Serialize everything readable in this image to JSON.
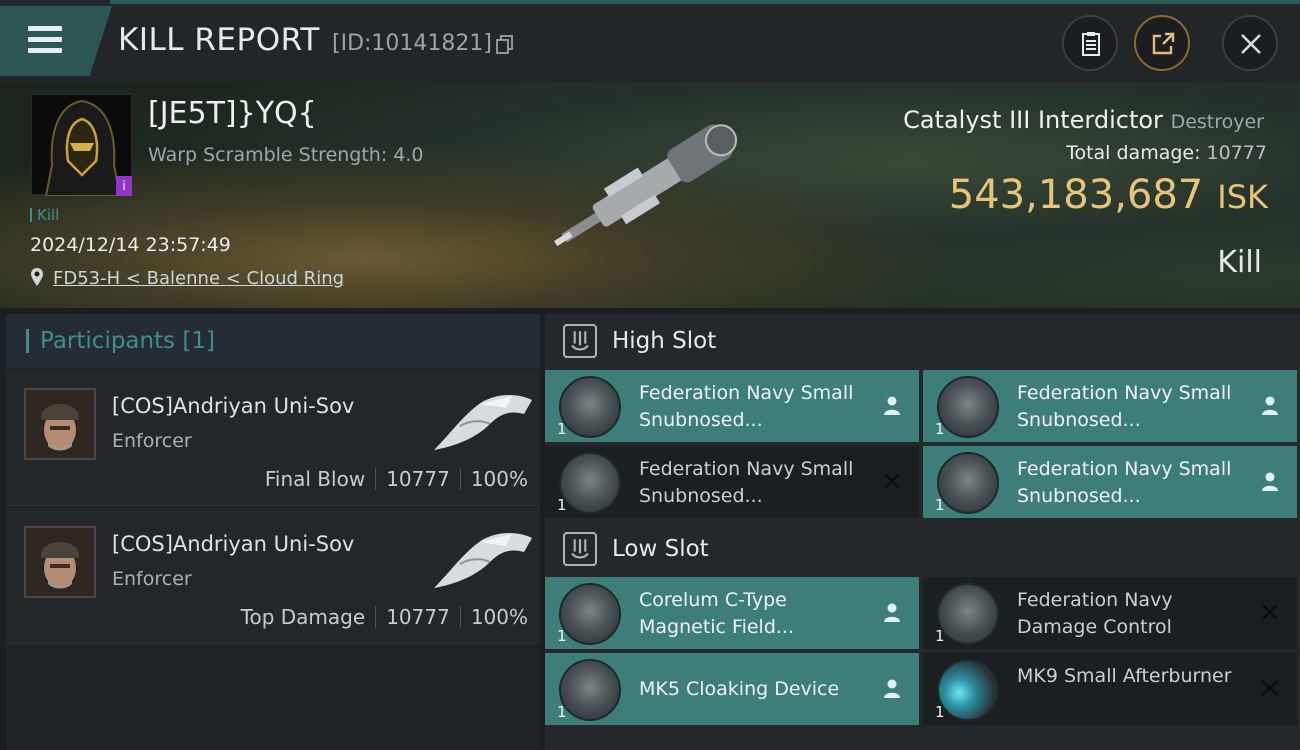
{
  "header": {
    "title": "KILL REPORT",
    "report_id": "[ID:10141821]",
    "buttons": [
      "clipboard-icon",
      "share-icon",
      "close-icon"
    ]
  },
  "victim": {
    "name": "[JE5T]}YQ{",
    "scramble": "Warp Scramble Strength: 4.0",
    "tag": "Kill",
    "datetime": "2024/12/14 23:57:49",
    "location": "FD53-H < Balenne < Cloud Ring",
    "ship_name": "Catalyst III Interdictor",
    "ship_class": "Destroyer",
    "total_damage_label": "Total damage:",
    "total_damage": "10777",
    "isk_value": "543,183,687",
    "isk_unit": "ISK",
    "result": "Kill",
    "info_badge": "i"
  },
  "participants": {
    "title": "Participants [1]",
    "rows": [
      {
        "name": "[COS]Andriyan Uni-Sov",
        "ship": "Enforcer",
        "role": "Final Blow",
        "damage": "10777",
        "percent": "100%"
      },
      {
        "name": "[COS]Andriyan Uni-Sov",
        "ship": "Enforcer",
        "role": "Top Damage",
        "damage": "10777",
        "percent": "100%"
      }
    ]
  },
  "slots": {
    "high": {
      "label": "High Slot",
      "modules": [
        {
          "name": "Federation Navy Small Snubnosed...",
          "qty": "1",
          "status": "dropped"
        },
        {
          "name": "Federation Navy Small Snubnosed...",
          "qty": "1",
          "status": "dropped"
        },
        {
          "name": "Federation Navy Small Snubnosed...",
          "qty": "1",
          "status": "destroyed"
        },
        {
          "name": "Federation Navy Small Snubnosed...",
          "qty": "1",
          "status": "dropped"
        }
      ]
    },
    "low": {
      "label": "Low Slot",
      "modules": [
        {
          "name": "Corelum C-Type Magnetic Field...",
          "qty": "1",
          "status": "dropped"
        },
        {
          "name": "Federation Navy Damage Control",
          "qty": "1",
          "status": "destroyed"
        },
        {
          "name": "MK5 Cloaking Device",
          "qty": "1",
          "status": "dropped"
        },
        {
          "name": "MK9 Small Afterburner",
          "qty": "1",
          "status": "destroyed"
        }
      ]
    }
  },
  "colors": {
    "accent_teal": "#3e8e8a",
    "dropped_bg": "#3e7e79",
    "destroyed_bg": "#1b1f22",
    "isk_gold": "#e6c47a"
  }
}
